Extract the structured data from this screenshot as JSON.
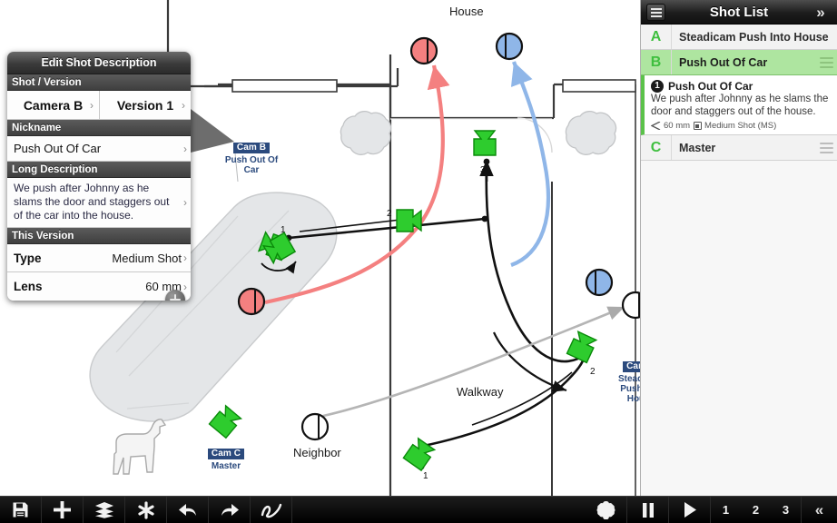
{
  "edit_panel": {
    "title": "Edit Shot Description",
    "sections": {
      "shot_version": "Shot / Version",
      "nickname": "Nickname",
      "long_description": "Long Description",
      "this_version": "This Version"
    },
    "camera_value": "Camera B",
    "version_value": "Version 1",
    "nickname_value": "Push Out Of Car",
    "long_description_value": "We push after Johnny as he slams the door and staggers out of the car into the house.",
    "type_label": "Type",
    "type_value": "Medium Shot",
    "lens_label": "Lens",
    "lens_value": "60 mm",
    "add_icon": "plus-icon",
    "chevron": "›"
  },
  "shot_list": {
    "title": "Shot List",
    "menu_icon": "list-menu-icon",
    "collapse_icon": "chevron-double-right-icon",
    "collapse_glyph": "»",
    "rows": [
      {
        "letter": "A",
        "name": "Steadicam Push Into House",
        "selected": false,
        "handle": false
      },
      {
        "letter": "B",
        "name": "Push Out Of Car",
        "selected": true,
        "handle": true
      }
    ],
    "detail": {
      "number": "1",
      "title": "Push Out Of Car",
      "body": "We push after Johnny as he slams the door and staggers out of the house.",
      "lens": "60 mm",
      "shot_type": "Medium Shot (MS)",
      "lens_icon": "lens-angle-icon",
      "frame_icon": "frame-icon"
    },
    "row_after": {
      "letter": "C",
      "name": "Master",
      "selected": false,
      "handle": true
    }
  },
  "map": {
    "labels": {
      "house": "House",
      "walkway": "Walkway",
      "neighbor": "Neighbor"
    },
    "camera_tags": [
      {
        "id": "cam-b",
        "name": "Cam B",
        "desc": "Push Out Of Car"
      },
      {
        "id": "cam-c",
        "name": "Cam C",
        "desc": "Master"
      },
      {
        "id": "cam-a",
        "name": "Cam A",
        "desc": "Steadicam Push Into House"
      }
    ],
    "path_markers": {
      "one": "1",
      "two": "2",
      "three": "3"
    },
    "colors": {
      "camera_green": "#2ecc2e",
      "character_red": "#f48080",
      "character_blue": "#8fb6e8",
      "building_fill": "#e4e6e8",
      "accent_green": "#3fbf3f",
      "tag_blue": "#2b4a7d"
    }
  },
  "toolbar": {
    "buttons": [
      {
        "name": "save-button",
        "icon": "floppy-disk-icon"
      },
      {
        "name": "add-button",
        "icon": "plus-icon"
      },
      {
        "name": "layers-button",
        "icon": "layers-icon"
      },
      {
        "name": "effects-button",
        "icon": "asterisk-icon"
      },
      {
        "name": "undo-button",
        "icon": "undo-arrow-icon"
      },
      {
        "name": "redo-button",
        "icon": "redo-arrow-icon"
      },
      {
        "name": "draw-button",
        "icon": "squiggle-icon"
      },
      {
        "name": "settings-button",
        "icon": "gear-icon"
      },
      {
        "name": "pause-button",
        "icon": "pause-icon"
      },
      {
        "name": "play-button",
        "icon": "play-icon"
      }
    ],
    "page_numbers": [
      "1",
      "2",
      "3"
    ],
    "collapse_glyph": "«",
    "collapse_icon": "chevron-double-left-icon"
  }
}
